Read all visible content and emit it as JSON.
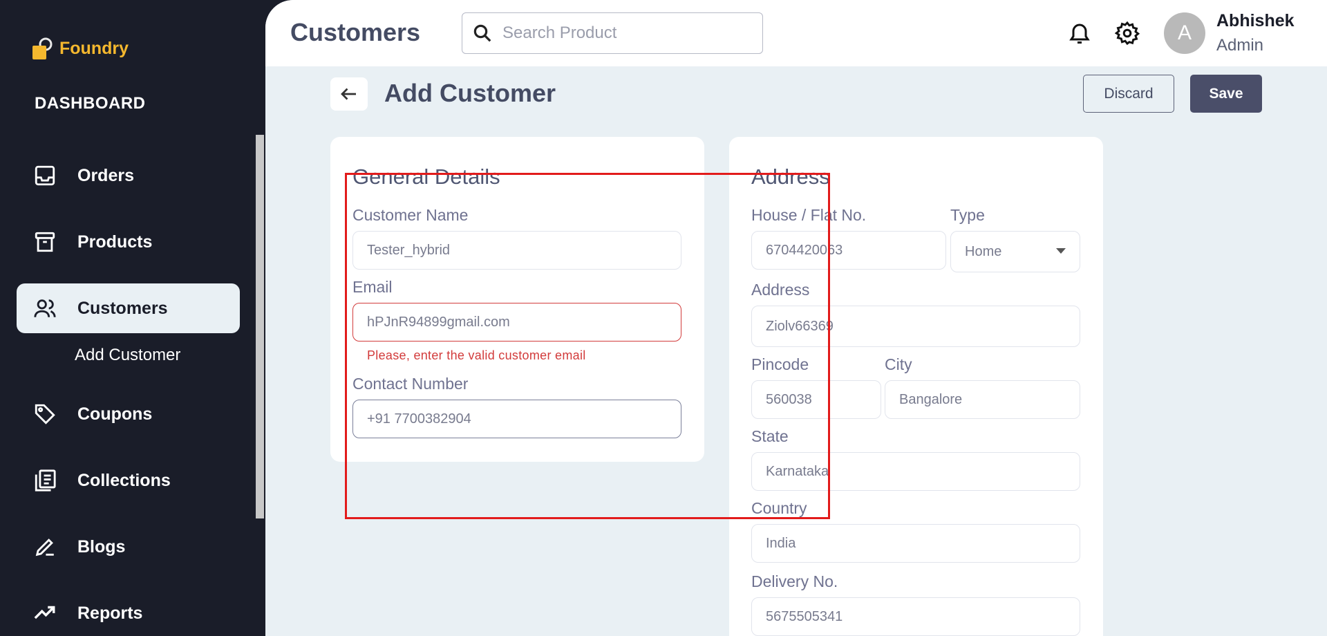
{
  "sidebar": {
    "brand": "Foundry",
    "section_title": "DASHBOARD",
    "items": [
      {
        "label": "Orders"
      },
      {
        "label": "Products"
      },
      {
        "label": "Customers"
      },
      {
        "label": "Coupons"
      },
      {
        "label": "Collections"
      },
      {
        "label": "Blogs"
      },
      {
        "label": "Reports"
      }
    ],
    "sub_item": "Add Customer"
  },
  "header": {
    "title": "Customers",
    "search_placeholder": "Search Product",
    "user": {
      "initial": "A",
      "name": "Abhishek",
      "role": "Admin"
    }
  },
  "page": {
    "title": "Add Customer",
    "discard_label": "Discard",
    "save_label": "Save"
  },
  "general": {
    "title": "General Details",
    "name_label": "Customer Name",
    "name_value": "Tester_hybrid",
    "email_label": "Email",
    "email_value": "hPJnR94899gmail.com",
    "email_error": "Please, enter the valid customer email",
    "contact_label": "Contact Number",
    "contact_value": "+91 7700382904"
  },
  "address": {
    "title": "Address",
    "house_label": "House / Flat No.",
    "house_value": "6704420063",
    "type_label": "Type",
    "type_value": "Home",
    "address_label": "Address",
    "address_value": "Ziolv66369",
    "pincode_label": "Pincode",
    "pincode_value": "560038",
    "city_label": "City",
    "city_value": "Bangalore",
    "state_label": "State",
    "state_value": "Karnataka",
    "country_label": "Country",
    "country_value": "India",
    "delivery_label": "Delivery No.",
    "delivery_value": "5675505341"
  },
  "colors": {
    "sidebar_bg": "#1a1d29",
    "brand": "#f5b82e",
    "error": "#d23b3b",
    "primary_button": "#4a4e69",
    "highlight_box": "#e21b1b"
  }
}
